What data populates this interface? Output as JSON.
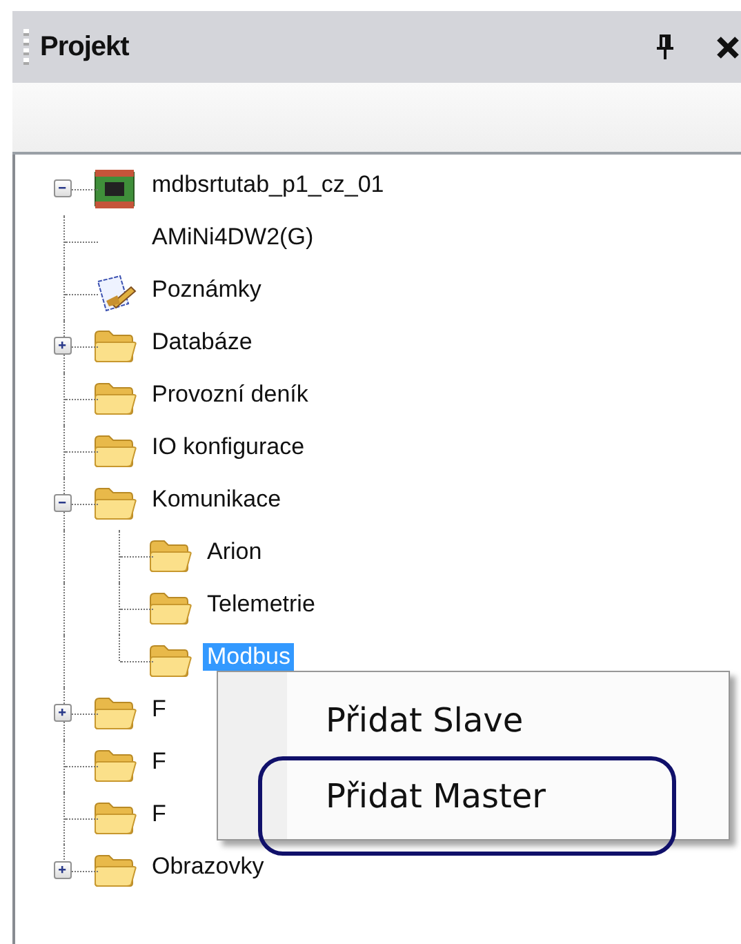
{
  "panel": {
    "title": "Projekt"
  },
  "tree": [
    {
      "label": "mdbsrtutab_p1_cz_01",
      "kind": "device",
      "expanded": true,
      "selected": false,
      "children": [
        {
          "label": "AMiNi4DW2(G)",
          "kind": "none",
          "selected": false
        },
        {
          "label": "Poznámky",
          "kind": "notes",
          "selected": false
        },
        {
          "label": "Databáze",
          "kind": "folder",
          "expanded": false,
          "selected": false
        },
        {
          "label": "Provozní deník",
          "kind": "folder",
          "selected": false
        },
        {
          "label": "IO konfigurace",
          "kind": "folder",
          "selected": false
        },
        {
          "label": "Komunikace",
          "kind": "folder",
          "expanded": true,
          "selected": false,
          "children": [
            {
              "label": "Arion",
              "kind": "folder",
              "selected": false
            },
            {
              "label": "Telemetrie",
              "kind": "folder",
              "selected": false
            },
            {
              "label": "Modbus",
              "kind": "folder",
              "selected": true
            }
          ]
        },
        {
          "label": "F",
          "kind": "folder",
          "expanded": false,
          "selected": false
        },
        {
          "label": "F",
          "kind": "folder",
          "selected": false
        },
        {
          "label": "F",
          "kind": "folder",
          "selected": false
        },
        {
          "label": "Obrazovky",
          "kind": "folder",
          "expanded": false,
          "selected": false
        }
      ]
    }
  ],
  "context_menu": {
    "items": [
      {
        "label": "Přidat Slave",
        "circled": false
      },
      {
        "label": "Přidat Master",
        "circled": true
      }
    ]
  }
}
